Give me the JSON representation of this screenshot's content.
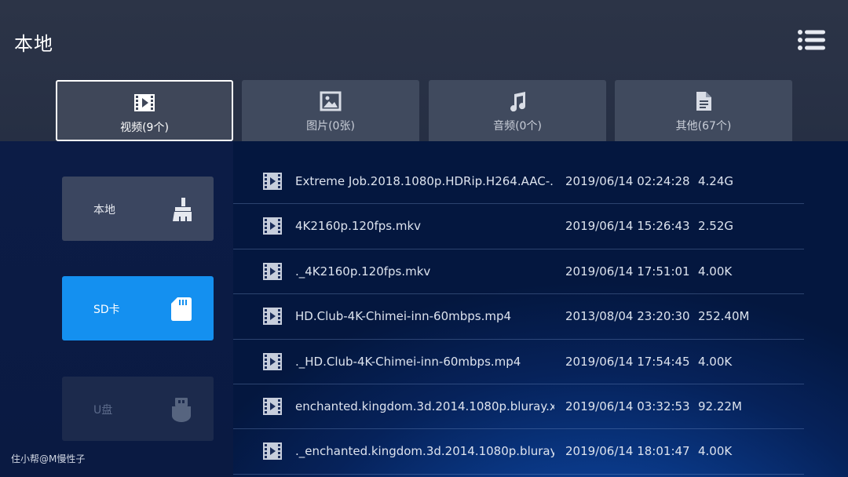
{
  "header": {
    "title": "本地",
    "menu_icon": "list-menu-icon"
  },
  "tabs": [
    {
      "label": "视频(9个)",
      "icon": "video-icon",
      "active": true
    },
    {
      "label": "图片(0张)",
      "icon": "image-icon",
      "active": false
    },
    {
      "label": "音频(0个)",
      "icon": "music-icon",
      "active": false
    },
    {
      "label": "其他(67个)",
      "icon": "document-icon",
      "active": false
    }
  ],
  "sidebar": {
    "items": [
      {
        "label": "本地",
        "icon": "broom-clean-icon",
        "state": "normal"
      },
      {
        "label": "SD卡",
        "icon": "sd-card-icon",
        "state": "selected"
      },
      {
        "label": "U盘",
        "icon": "usb-drive-icon",
        "state": "disabled"
      }
    ]
  },
  "files": [
    {
      "name": "Extreme Job.2018.1080p.HDRip.H264.AAC-..",
      "date": "2019/06/14 02:24:28",
      "size": "4.24G"
    },
    {
      "name": "4K2160p.120fps.mkv",
      "date": "2019/06/14 15:26:43",
      "size": "2.52G"
    },
    {
      "name": "._4K2160p.120fps.mkv",
      "date": "2019/06/14 17:51:01",
      "size": "4.00K"
    },
    {
      "name": "HD.Club-4K-Chimei-inn-60mbps.mp4",
      "date": "2013/08/04 23:20:30",
      "size": "252.40M"
    },
    {
      "name": "._HD.Club-4K-Chimei-inn-60mbps.mp4",
      "date": "2019/06/14 17:54:45",
      "size": "4.00K"
    },
    {
      "name": "enchanted.kingdom.3d.2014.1080p.bluray.x..",
      "date": "2019/06/14 03:32:53",
      "size": "92.22M"
    },
    {
      "name": "._enchanted.kingdom.3d.2014.1080p.bluray..",
      "date": "2019/06/14 18:01:47",
      "size": "4.00K"
    }
  ],
  "watermark": "住小帮@M慢性子",
  "colors": {
    "accent": "#1490f0",
    "tab_bg": "#404a5e",
    "card_bg": "#3b4660"
  }
}
